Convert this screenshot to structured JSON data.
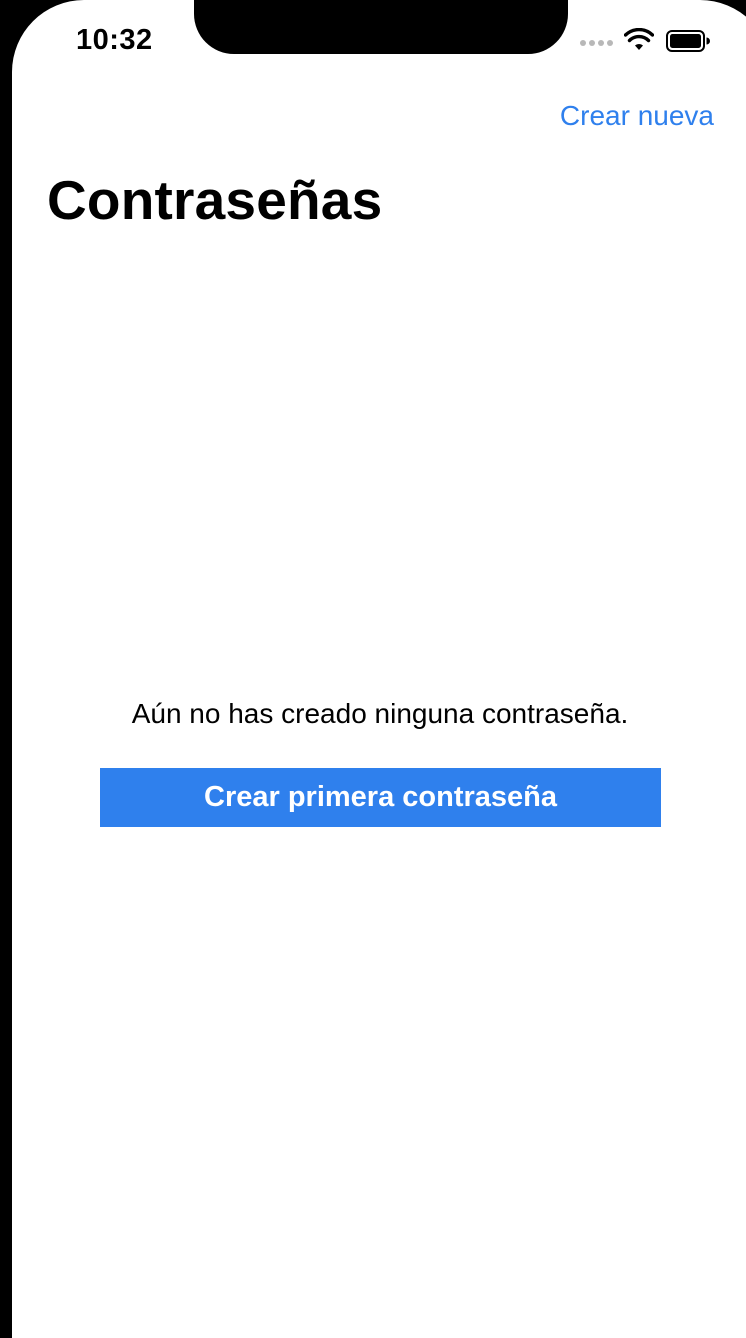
{
  "status_bar": {
    "time": "10:32",
    "icons": [
      "cellular-signal-icon",
      "wifi-icon",
      "battery-icon"
    ]
  },
  "nav": {
    "action_label": "Crear nueva",
    "title": "Contraseñas"
  },
  "empty_state": {
    "message": "Aún no has creado ninguna contraseña.",
    "button_label": "Crear primera contraseña"
  },
  "colors": {
    "accent": "#2f80ed",
    "background": "#ffffff",
    "text": "#000000",
    "device_frame": "#000000"
  }
}
